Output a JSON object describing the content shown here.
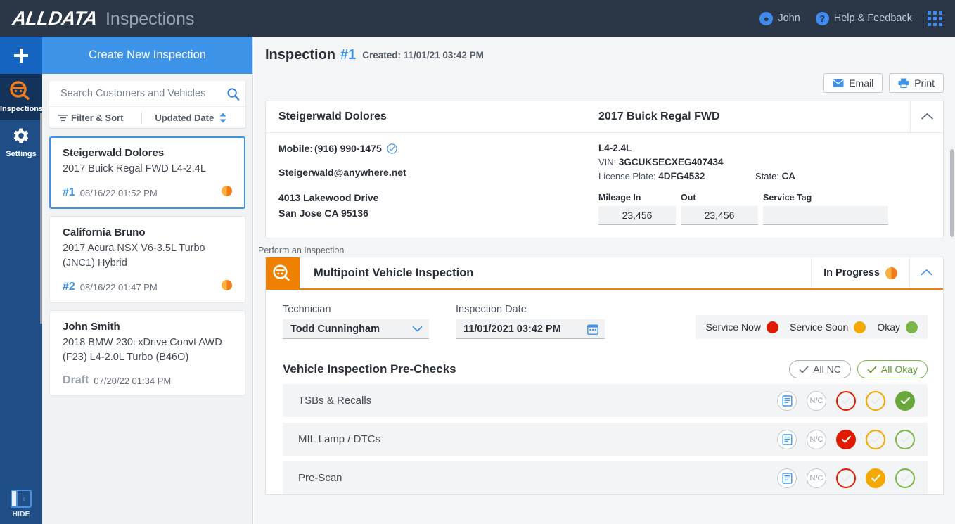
{
  "topbar": {
    "brand_primary": "ALLDATA",
    "brand_secondary": "Inspections",
    "user": "John",
    "help": "Help & Feedback",
    "user_icon": "account-circle-icon",
    "help_icon": "help-circle-icon",
    "apps_icon": "apps-grid-icon"
  },
  "rail": {
    "add_icon": "plus-icon",
    "items": [
      {
        "label": "Inspections",
        "icon": "inspection-magnifier-icon",
        "active": true
      },
      {
        "label": "Settings",
        "icon": "gear-icon",
        "active": false
      }
    ],
    "hide_label": "HIDE",
    "hide_icon": "collapse-panel-icon"
  },
  "list_panel": {
    "create_button": "Create New Inspection",
    "search": {
      "placeholder": "Search Customers and Vehicles",
      "value": "",
      "icon": "search-icon"
    },
    "filter_label": "Filter & Sort",
    "filter_icon": "filter-icon",
    "sort_label": "Updated Date",
    "sort_icon": "sort-updown-icon",
    "cards": [
      {
        "name": "Steigerwald Dolores",
        "vehicle": "2017 Buick Regal FWD L4-2.4L",
        "number": "#1",
        "date": "08/16/22 01:52 PM",
        "status_icon": "in-progress-pie-icon",
        "selected": true
      },
      {
        "name": "California Bruno",
        "vehicle": "2017 Acura NSX V6-3.5L Turbo (JNC1) Hybrid",
        "number": "#2",
        "date": "08/16/22 01:47 PM",
        "status_icon": "in-progress-pie-icon",
        "selected": false
      },
      {
        "name": "John Smith",
        "vehicle": "2018 BMW 230i xDrive Convt AWD (F23) L4-2.0L Turbo (B46O)",
        "number": "Draft",
        "date": "07/20/22 01:34 PM",
        "status_icon": "",
        "selected": false
      }
    ]
  },
  "main": {
    "header": {
      "title": "Inspection",
      "number": "#1",
      "created": "Created: 11/01/21 03:42 PM"
    },
    "actions": [
      {
        "label": "Email",
        "icon": "envelope-icon"
      },
      {
        "label": "Print",
        "icon": "printer-icon"
      }
    ],
    "customer_panel": {
      "customer_name": "Steigerwald Dolores",
      "vehicle_name": "2017 Buick Regal FWD",
      "collapse_icon": "chevron-up-icon",
      "mobile_label": "Mobile:",
      "mobile_value": "(916) 990-1475",
      "mobile_verified_icon": "check-circle-icon",
      "email": "Steigerwald@anywhere.net",
      "address_line1": "4013 Lakewood Drive",
      "address_line2": "San Jose CA 95136",
      "engine": "L4-2.4L",
      "vin_label": "VIN:",
      "vin_value": "3GCUKSECXEG407434",
      "plate_label": "License Plate:",
      "plate_value": "4DFG4532",
      "state_label": "State:",
      "state_value": "CA",
      "mileage_in_label": "Mileage In",
      "mileage_in_value": "23,456",
      "mileage_out_label": "Out",
      "mileage_out_value": "23,456",
      "service_tag_label": "Service Tag",
      "service_tag_value": ""
    },
    "perform_label": "Perform an Inspection",
    "inspection": {
      "icon": "inspection-magnifier-icon",
      "title": "Multipoint Vehicle Inspection",
      "status": "In Progress",
      "status_icon": "in-progress-pie-icon",
      "collapse_icon": "chevron-up-icon",
      "technician_label": "Technician",
      "technician_value": "Todd Cunningham",
      "technician_icon": "chevron-down-icon",
      "date_label": "Inspection Date",
      "date_value": "11/01/2021 03:42 PM",
      "date_icon": "calendar-icon",
      "legend": [
        {
          "label": "Service Now",
          "color": "#e01b00"
        },
        {
          "label": "Service Soon",
          "color": "#f5a800"
        },
        {
          "label": "Okay",
          "color": "#7ab648"
        }
      ],
      "section_title": "Vehicle Inspection Pre-Checks",
      "bulk_actions": [
        {
          "label": "All NC",
          "icon": "check-icon",
          "style": "plain"
        },
        {
          "label": "All Okay",
          "icon": "check-icon",
          "style": "okay"
        }
      ],
      "rows": [
        {
          "label": "TSBs & Recalls",
          "note_icon": "note-document-icon",
          "nc_label": "N/C",
          "red_selected": false,
          "yellow_selected": false,
          "green_selected": true
        },
        {
          "label": "MIL Lamp / DTCs",
          "note_icon": "note-document-icon",
          "nc_label": "N/C",
          "red_selected": true,
          "yellow_selected": false,
          "green_selected": false
        },
        {
          "label": "Pre-Scan",
          "note_icon": "note-document-icon",
          "nc_label": "N/C",
          "red_selected": false,
          "yellow_selected": true,
          "green_selected": false
        }
      ]
    }
  },
  "colors": {
    "brand_dark": "#2b3647",
    "accent_blue": "#3d93e8",
    "accent_orange": "#f08000",
    "red": "#e01b00",
    "yellow": "#f5a800",
    "green": "#7ab648"
  }
}
